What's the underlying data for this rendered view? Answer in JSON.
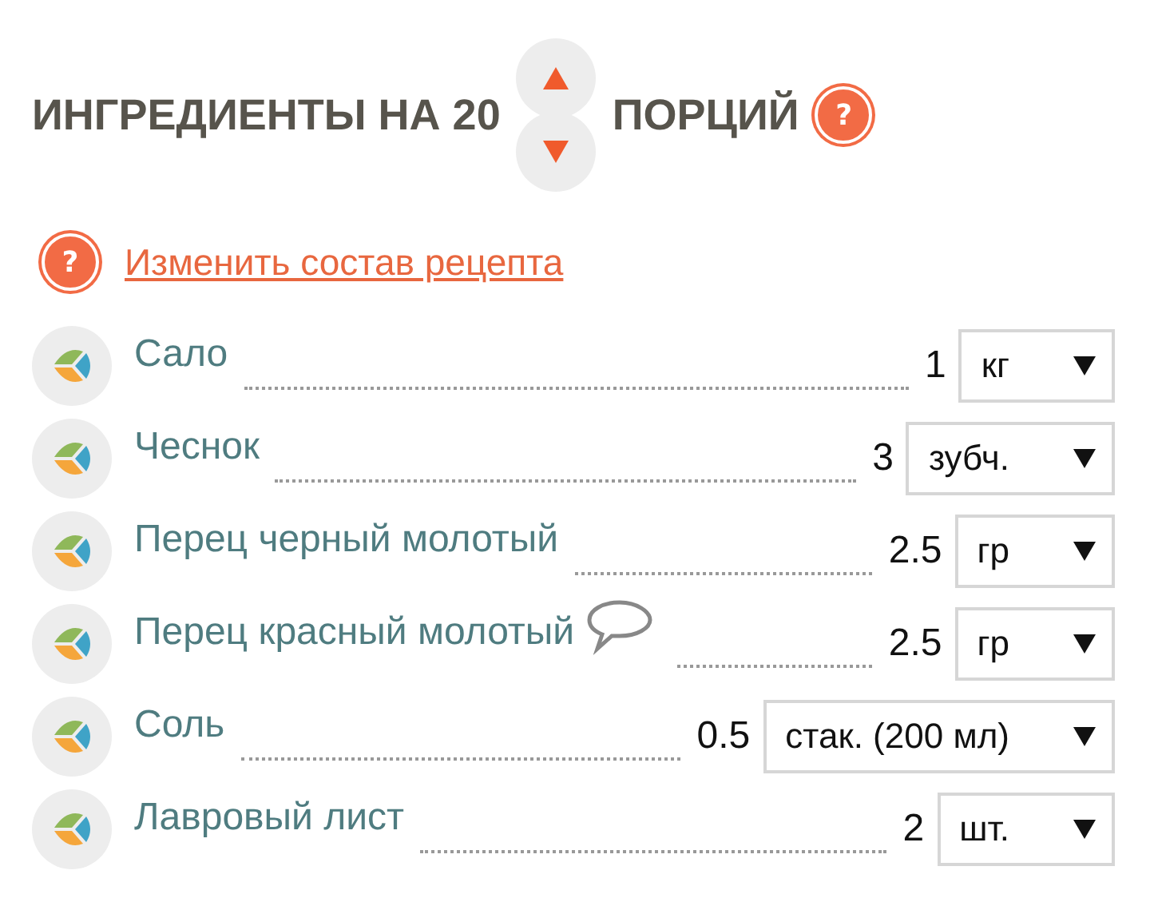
{
  "heading": {
    "before": "ИНГРЕДИЕНТЫ НА 20",
    "after": "ПОРЦИЙ",
    "help": "?"
  },
  "change_link": {
    "help": "?",
    "label": "Изменить состав рецепта"
  },
  "ingredients": [
    {
      "name": "Сало",
      "comment": false,
      "amount": "1",
      "unit": "кг"
    },
    {
      "name": "Чеснок",
      "comment": false,
      "amount": "3",
      "unit": "зубч."
    },
    {
      "name": "Перец черный молотый",
      "comment": false,
      "amount": "2.5",
      "unit": "гр"
    },
    {
      "name": "Перец красный молотый",
      "comment": true,
      "amount": "2.5",
      "unit": "гр"
    },
    {
      "name": "Соль",
      "comment": false,
      "amount": "0.5",
      "unit": "стак. (200 мл)"
    },
    {
      "name": "Лавровый лист",
      "comment": false,
      "amount": "2",
      "unit": "шт."
    }
  ]
}
